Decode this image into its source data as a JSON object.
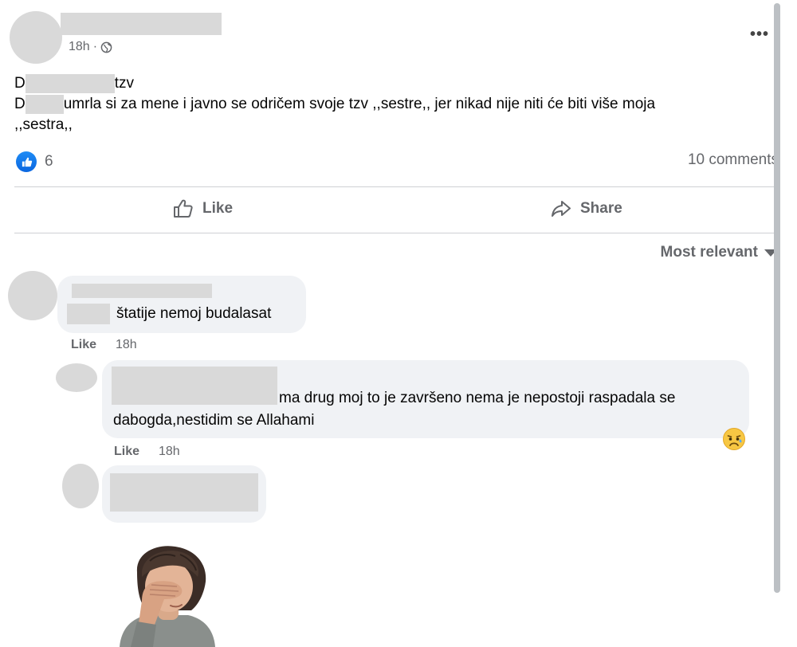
{
  "post": {
    "time": "18h",
    "separator": "·",
    "more_label": "•••",
    "text": {
      "line1_a": "D",
      "line1_b": "tzv",
      "line2_a": "D",
      "line2_b": "umrla si za mene i javno se odričem svoje tzv ,,sestre,, jer nikad nije niti će biti više moja",
      "line3": ",,sestra,,"
    },
    "reaction_count": "6",
    "comments_count": "10 comments"
  },
  "actions": {
    "like_label": "Like",
    "share_label": "Share"
  },
  "sort": {
    "label": "Most relevant"
  },
  "comments": [
    {
      "text": "štatije nemoj budalasat",
      "like_label": "Like",
      "time": "18h"
    },
    {
      "text_line1": "ma drug moj to je završeno nema je nepostoji raspadala se",
      "text_line2": "dabogda,nestidim se Allahami",
      "like_label": "Like",
      "time": "18h",
      "reaction_icon": "sad-face-emoji"
    },
    {
      "sticker": "facepalm-sticker"
    }
  ],
  "colors": {
    "like_blue": "#1877f2",
    "bubble_bg": "#f0f2f5",
    "secondary_text": "#65676b",
    "redaction": "#d9d9d9"
  }
}
